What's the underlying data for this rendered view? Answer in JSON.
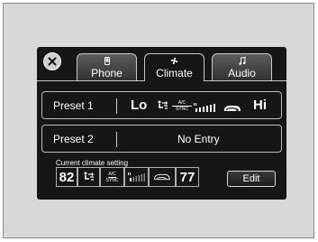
{
  "tabs": [
    {
      "label": "Phone",
      "icon": "phone-icon"
    },
    {
      "label": "Climate",
      "icon": "fan-icon",
      "active": true
    },
    {
      "label": "Audio",
      "icon": "music-note-icon"
    }
  ],
  "presets": [
    {
      "label": "Preset 1",
      "temp_low": "Lo",
      "ac_label_top": "A/C",
      "ac_label_bottom": "SYNC",
      "temp_high": "Hi"
    },
    {
      "label": "Preset 2",
      "value": "No Entry"
    }
  ],
  "current": {
    "label": "Current climate setting",
    "driver_temp": "82",
    "ac_label_top": "A/C",
    "ac_label_bottom": "SYNC",
    "passenger_temp": "77"
  },
  "edit_label": "Edit",
  "icons": [
    "close-icon",
    "phone-icon",
    "fan-icon",
    "music-note-icon",
    "air-flow-icon",
    "fan-speed-icon",
    "recirculation-icon"
  ],
  "colors": {
    "screen": "#161616",
    "border": "#c8c8c8",
    "text": "#ffffff",
    "frame": "#d8d8d8"
  }
}
